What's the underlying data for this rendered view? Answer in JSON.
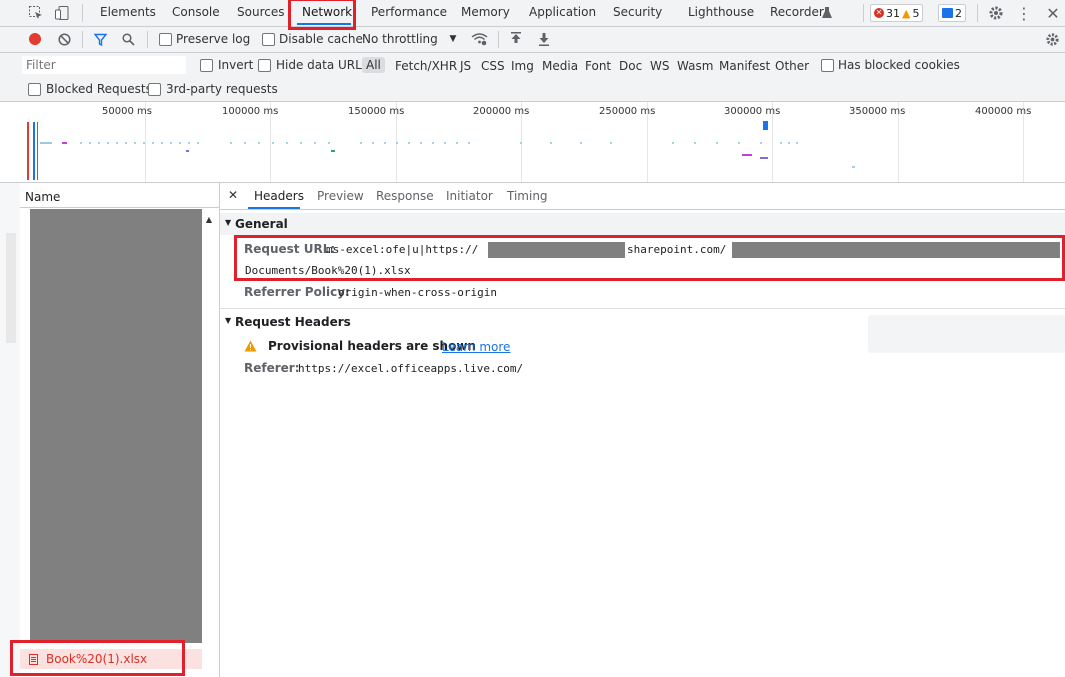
{
  "tabs": [
    "Elements",
    "Console",
    "Sources",
    "Network",
    "Performance",
    "Memory",
    "Application",
    "Security",
    "Lighthouse",
    "Recorder"
  ],
  "badges": {
    "errors": "31",
    "warnings": "5",
    "messages": "2"
  },
  "toolbar": {
    "preserve_log": "Preserve log",
    "disable_cache": "Disable cache",
    "throttling": "No throttling"
  },
  "filter": {
    "placeholder": "Filter",
    "invert": "Invert",
    "hide_data_urls": "Hide data URLs",
    "types": [
      "All",
      "Fetch/XHR",
      "JS",
      "CSS",
      "Img",
      "Media",
      "Font",
      "Doc",
      "WS",
      "Wasm",
      "Manifest",
      "Other"
    ],
    "has_blocked_cookies": "Has blocked cookies",
    "blocked_requests": "Blocked Requests",
    "third_party": "3rd-party requests"
  },
  "overview": {
    "ticks": [
      "50000 ms",
      "100000 ms",
      "150000 ms",
      "200000 ms",
      "250000 ms",
      "300000 ms",
      "350000 ms",
      "400000 ms"
    ]
  },
  "list": {
    "header": "Name",
    "selected_item": "Book%20(1).xlsx"
  },
  "detail": {
    "tabs": [
      "Headers",
      "Preview",
      "Response",
      "Initiator",
      "Timing"
    ],
    "general_title": "General",
    "request_url_key": "Request URL:",
    "request_url_prefix": "ms-excel:ofe|u|https://",
    "request_url_domain": "sharepoint.com/",
    "request_url_line2": "Documents/Book%20(1).xlsx",
    "referrer_policy_key": "Referrer Policy:",
    "referrer_policy_value": "origin-when-cross-origin",
    "request_headers_title": "Request Headers",
    "provisional_text": "Provisional headers are shown",
    "learn_more": "Learn more",
    "referer_key": "Referer:",
    "referer_value": "https://excel.officeapps.live.com/"
  },
  "colors": {
    "accent": "#1a73e8",
    "highlight": "#e0202a",
    "redaction": "#808080"
  }
}
